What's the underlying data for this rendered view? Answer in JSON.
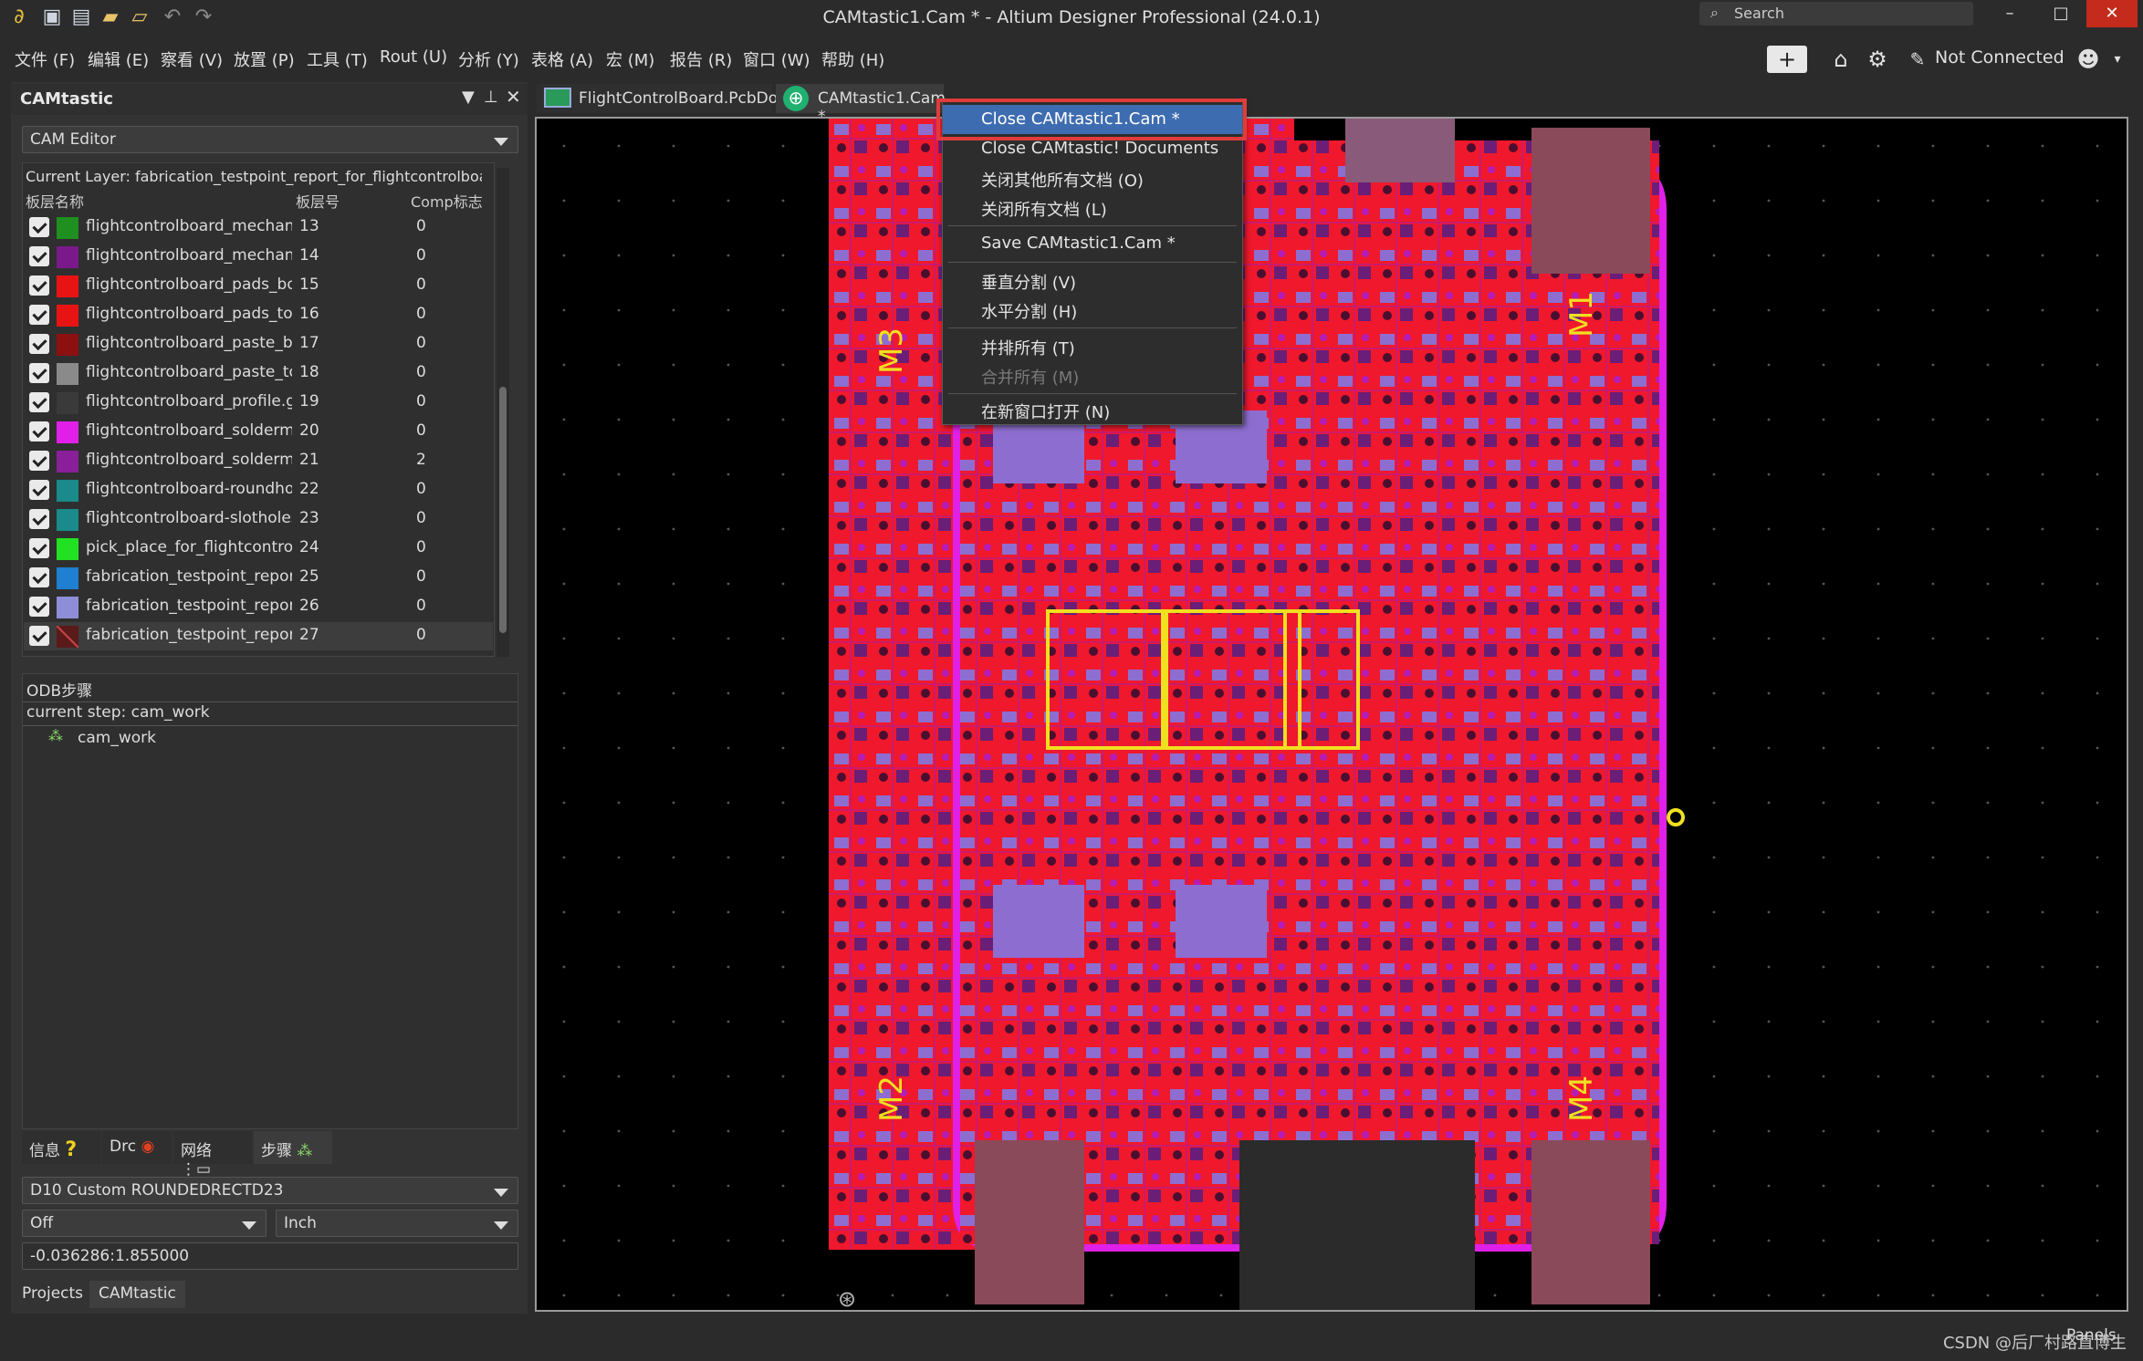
{
  "window": {
    "title": "CAMtastic1.Cam * - Altium Designer Professional (24.0.1)",
    "search_placeholder": "Search",
    "minimize_icon": "minimize-icon",
    "maximize_icon": "maximize-icon",
    "close_icon": "close-icon"
  },
  "menu": [
    "文件 (F)",
    "编辑 (E)",
    "察看 (V)",
    "放置 (P)",
    "工具 (T)",
    "Rout (U)",
    "分析 (Y)",
    "表格 (A)",
    "宏 (M)",
    "报告 (R)",
    "窗口 (W)",
    "帮助 (H)"
  ],
  "header_right": {
    "connection": "Not Connected"
  },
  "panel": {
    "title": "CAMtastic",
    "editor_combo": "CAM Editor",
    "current_layer": "Current Layer: fabrication_testpoint_report_for_flightcontrolboard...",
    "col_name": "板层名称",
    "col_num": "板层号",
    "col_comp": "Comp标志",
    "layers": [
      {
        "name": "flightcontrolboard_mechanica",
        "num": "13",
        "comp": "0",
        "color": "#1f8f1f"
      },
      {
        "name": "flightcontrolboard_mechanica",
        "num": "14",
        "comp": "0",
        "color": "#7a1a8a"
      },
      {
        "name": "flightcontrolboard_pads_bot.g",
        "num": "15",
        "comp": "0",
        "color": "#e81414"
      },
      {
        "name": "flightcontrolboard_pads_top.g",
        "num": "16",
        "comp": "0",
        "color": "#e81414"
      },
      {
        "name": "flightcontrolboard_paste_bot.(",
        "num": "17",
        "comp": "0",
        "color": "#8c1010"
      },
      {
        "name": "flightcontrolboard_paste_top.(",
        "num": "18",
        "comp": "0",
        "color": "#8a8a8a"
      },
      {
        "name": "flightcontrolboard_profile.gbr",
        "num": "19",
        "comp": "0",
        "color": "#3a3a3a"
      },
      {
        "name": "flightcontrolboard_soldermask",
        "num": "20",
        "comp": "0",
        "color": "#e020e8"
      },
      {
        "name": "flightcontrolboard_soldermask",
        "num": "21",
        "comp": "2",
        "color": "#8a1f9a"
      },
      {
        "name": "flightcontrolboard-roundholes",
        "num": "22",
        "comp": "0",
        "color": "#1a8a8a"
      },
      {
        "name": "flightcontrolboard-slotholes.tx",
        "num": "23",
        "comp": "0",
        "color": "#1a8a8a"
      },
      {
        "name": "pick_place_for_flightcontrolbo",
        "num": "24",
        "comp": "0",
        "color": "#22e022"
      },
      {
        "name": "fabrication_testpoint_report_fc",
        "num": "25",
        "comp": "0",
        "color": "#1f7fd0"
      },
      {
        "name": "fabrication_testpoint_report_fc",
        "num": "26",
        "comp": "0",
        "color": "#8e8ed8"
      },
      {
        "name": "fabrication_testpoint_report_fc",
        "num": "27",
        "comp": "0",
        "color": "#5a1a1a"
      }
    ],
    "odb_title": "ODB步骤",
    "current_step": "current step: cam_work",
    "step_item": "cam_work",
    "tabs": [
      "信息",
      "Drc",
      "网络",
      "步骤"
    ],
    "aperture": "D10   Custom    ROUNDEDRECTD23",
    "snap": "Off",
    "units": "Inch",
    "coords": "-0.036286:1.855000",
    "bottom_tabs": [
      "Projects",
      "CAMtastic"
    ]
  },
  "doc_tabs": [
    "FlightControlBoard.PcbDoc",
    "CAMtastic1.Cam *"
  ],
  "context_menu": [
    {
      "label": "Close CAMtastic1.Cam *",
      "state": "highlighted"
    },
    {
      "label": "Close CAMtastic! Documents",
      "state": "normal"
    },
    {
      "label": "关闭其他所有文档 (O)",
      "state": "normal"
    },
    {
      "label": "关闭所有文档 (L)",
      "state": "normal"
    },
    {
      "label": "Save CAMtastic1.Cam *",
      "state": "normal"
    },
    {
      "label": "垂直分割 (V)",
      "state": "normal"
    },
    {
      "label": "水平分割 (H)",
      "state": "normal"
    },
    {
      "label": "并排所有 (T)",
      "state": "normal"
    },
    {
      "label": "合并所有 (M)",
      "state": "disabled"
    },
    {
      "label": "在新窗口打开 (N)",
      "state": "normal"
    }
  ],
  "status": {
    "panels": "Panels",
    "watermark": "CSDN @后厂村路直博生"
  },
  "board_labels": {
    "m1": "M1",
    "m2": "M2",
    "m3": "M3",
    "m4": "M4"
  }
}
